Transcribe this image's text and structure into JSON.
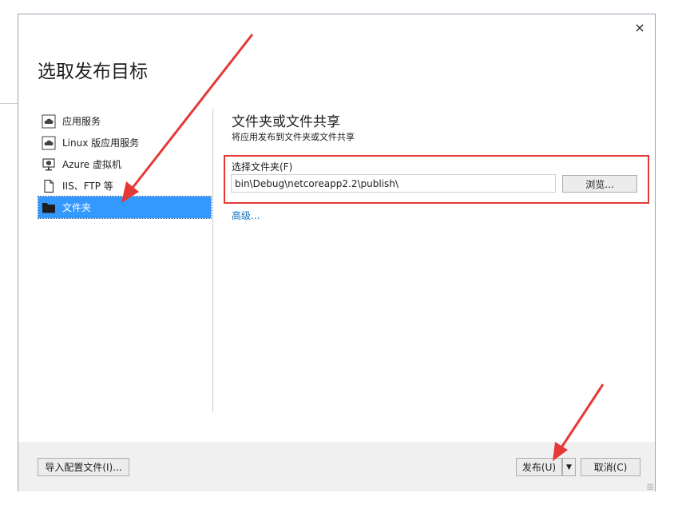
{
  "dialog": {
    "title": "选取发布目标",
    "close_glyph": "×"
  },
  "nav": {
    "items": [
      {
        "label": "应用服务",
        "icon": "app-service-icon",
        "selected": false
      },
      {
        "label": "Linux 版应用服务",
        "icon": "app-service-linux-icon",
        "selected": false
      },
      {
        "label": "Azure 虚拟机",
        "icon": "virtual-machine-icon",
        "selected": false
      },
      {
        "label": "IIS、FTP 等",
        "icon": "file-icon",
        "selected": false
      },
      {
        "label": "文件夹",
        "icon": "folder-icon",
        "selected": true
      }
    ]
  },
  "main": {
    "section_title": "文件夹或文件共享",
    "section_subtitle": "将应用发布到文件夹或文件共享",
    "folder_label": "选择文件夹(F)",
    "folder_value": "bin\\Debug\\netcoreapp2.2\\publish\\",
    "browse_label": "浏览...",
    "advanced_link": "高级..."
  },
  "footer": {
    "import_label": "导入配置文件(I)...",
    "publish_label": "发布(U)",
    "publish_dropdown_glyph": "▼",
    "cancel_label": "取消(C)"
  },
  "colors": {
    "accent": "#3399ff",
    "link": "#0e70c0",
    "annotation": "#e53935",
    "footer_bg": "#f0f0f0"
  }
}
